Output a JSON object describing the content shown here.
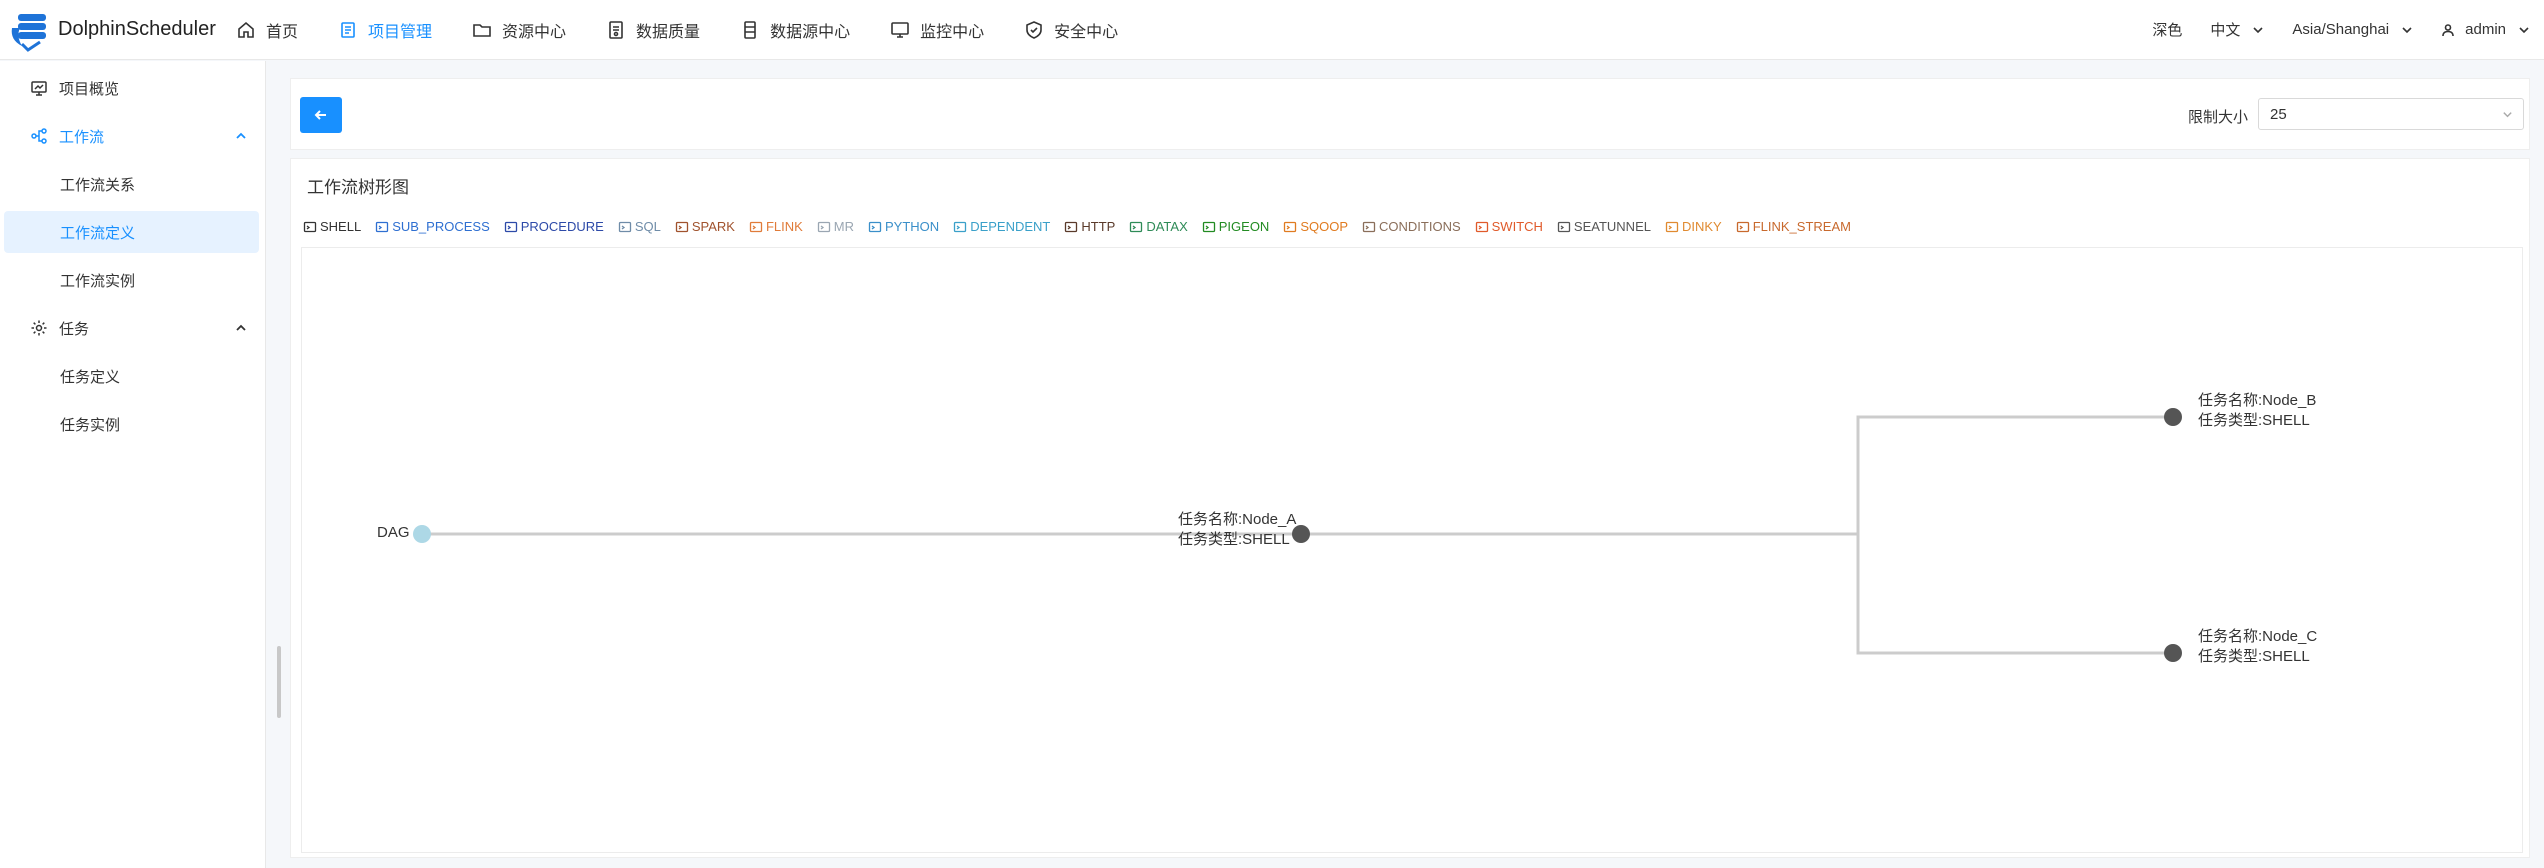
{
  "app": {
    "name": "DolphinScheduler"
  },
  "nav": [
    {
      "label": "首页",
      "icon": "home-icon"
    },
    {
      "label": "项目管理",
      "icon": "project-icon",
      "active": true
    },
    {
      "label": "资源中心",
      "icon": "folder-icon"
    },
    {
      "label": "数据质量",
      "icon": "data-quality-icon"
    },
    {
      "label": "数据源中心",
      "icon": "datasource-icon"
    },
    {
      "label": "监控中心",
      "icon": "monitor-icon"
    },
    {
      "label": "安全中心",
      "icon": "shield-icon"
    }
  ],
  "header_right": {
    "theme": "深色",
    "language": "中文",
    "timezone": "Asia/Shanghai",
    "user": "admin"
  },
  "sidebar": {
    "overview": "项目概览",
    "workflow_group": "工作流",
    "workflow_items": [
      "工作流关系",
      "工作流定义",
      "工作流实例"
    ],
    "task_group": "任务",
    "task_items": [
      "任务定义",
      "任务实例"
    ],
    "selected": "工作流定义"
  },
  "toolbar": {
    "limit_label": "限制大小",
    "limit_value": "25"
  },
  "tree": {
    "title": "工作流树形图",
    "legend": [
      {
        "label": "SHELL",
        "color": "#333333",
        "icon": "shell-icon"
      },
      {
        "label": "SUB_PROCESS",
        "color": "#2e6fd1",
        "icon": "sub-process-icon"
      },
      {
        "label": "PROCEDURE",
        "color": "#2d4aa8",
        "icon": "procedure-icon"
      },
      {
        "label": "SQL",
        "color": "#6f8ca8",
        "icon": "sql-icon"
      },
      {
        "label": "SPARK",
        "color": "#a0522d",
        "icon": "spark-icon"
      },
      {
        "label": "FLINK",
        "color": "#e07b39",
        "icon": "flink-icon"
      },
      {
        "label": "MR",
        "color": "#9aa6b2",
        "icon": "mr-icon"
      },
      {
        "label": "PYTHON",
        "color": "#3a8fc9",
        "icon": "python-icon"
      },
      {
        "label": "DEPENDENT",
        "color": "#3aa0c9",
        "icon": "dependent-icon"
      },
      {
        "label": "HTTP",
        "color": "#5a3a2a",
        "icon": "http-icon"
      },
      {
        "label": "DATAX",
        "color": "#2e8b57",
        "icon": "datax-icon"
      },
      {
        "label": "PIGEON",
        "color": "#228b22",
        "icon": "pigeon-icon"
      },
      {
        "label": "SQOOP",
        "color": "#e07b20",
        "icon": "sqoop-icon"
      },
      {
        "label": "CONDITIONS",
        "color": "#8a6e5a",
        "icon": "conditions-icon"
      },
      {
        "label": "SWITCH",
        "color": "#e05a2a",
        "icon": "switch-icon"
      },
      {
        "label": "SEATUNNEL",
        "color": "#555555",
        "icon": "seatunnel-icon"
      },
      {
        "label": "DINKY",
        "color": "#e08a30",
        "icon": "dinky-icon"
      },
      {
        "label": "FLINK_STREAM",
        "color": "#c8692d",
        "icon": "flink-stream-icon"
      }
    ],
    "root": {
      "label": "DAG",
      "color": "#add8e6"
    },
    "nodes": [
      {
        "id": "a",
        "name_line": "任务名称:Node_A",
        "type_line": "任务类型:SHELL"
      },
      {
        "id": "b",
        "name_line": "任务名称:Node_B",
        "type_line": "任务类型:SHELL"
      },
      {
        "id": "c",
        "name_line": "任务名称:Node_C",
        "type_line": "任务类型:SHELL"
      }
    ],
    "node_color": "#555555",
    "link_color": "#cccccc"
  }
}
